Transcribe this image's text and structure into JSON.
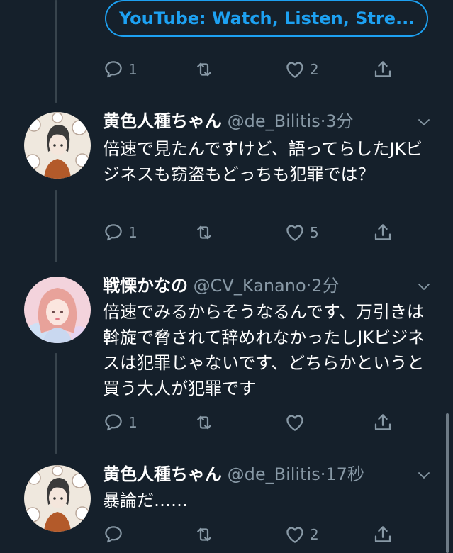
{
  "link_card": {
    "label": "YouTube: Watch, Listen, Stre..."
  },
  "tweets": [
    {
      "stats": {
        "replies": "1",
        "retweets": "",
        "likes": "2"
      }
    },
    {
      "name": "黄色人種ちゃん",
      "handle": "@de_Bilitis",
      "dot": "·",
      "time": "3分",
      "text": "倍速で見たんですけど、語ってらしたJKビジネスも窃盗もどっちも犯罪では？",
      "stats": {
        "replies": "1",
        "retweets": "",
        "likes": "5"
      }
    },
    {
      "name": "戦慄かなの",
      "handle": "@CV_Kanano",
      "dot": "·",
      "time": "2分",
      "text": "倍速でみるからそうなるんです、万引きは斡旋で脅されて辞めれなかったしJKビジネスは犯罪じゃないです、どちらかというと買う大人が犯罪です",
      "stats": {
        "replies": "1",
        "retweets": "",
        "likes": ""
      }
    },
    {
      "name": "黄色人種ちゃん",
      "handle": "@de_Bilitis",
      "dot": "·",
      "time": "17秒",
      "text": "暴論だ……",
      "stats": {
        "replies": "",
        "retweets": "",
        "likes": "2"
      }
    }
  ],
  "icons": {
    "reply": "reply-icon",
    "retweet": "retweet-icon",
    "like": "heart-icon",
    "share": "share-icon",
    "more": "chevron-down-icon"
  },
  "colors": {
    "background": "#15202b",
    "accent": "#1da1f2",
    "muted": "#8899a6",
    "thread_line": "#38444d"
  }
}
